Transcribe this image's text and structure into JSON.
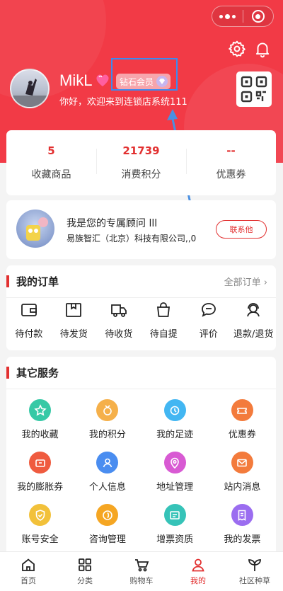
{
  "profile": {
    "username": "MikL",
    "vip_label": "钻石会员",
    "welcome": "你好，欢迎来到连锁店系统111"
  },
  "stats": [
    {
      "value": "5",
      "label": "收藏商品"
    },
    {
      "value": "21739",
      "label": "消费积分"
    },
    {
      "value": "--",
      "label": "优惠券"
    }
  ],
  "advisor": {
    "title": "我是您的专属顾问 lll",
    "company": "易族智汇（北京）科技有限公司,,0",
    "contact_label": "联系他"
  },
  "orders": {
    "title": "我的订单",
    "all_label": "全部订单",
    "items": [
      {
        "label": "待付款",
        "icon": "wallet-icon"
      },
      {
        "label": "待发货",
        "icon": "package-icon"
      },
      {
        "label": "待收货",
        "icon": "truck-icon"
      },
      {
        "label": "待自提",
        "icon": "bag-icon"
      },
      {
        "label": "评价",
        "icon": "comment-icon"
      },
      {
        "label": "退款/退货",
        "icon": "service-icon"
      }
    ]
  },
  "services": {
    "title": "其它服务",
    "items": [
      {
        "label": "我的收藏",
        "icon": "star-icon",
        "color": "#36c9a6"
      },
      {
        "label": "我的积分",
        "icon": "medal-icon",
        "color": "#f5b04a"
      },
      {
        "label": "我的足迹",
        "icon": "footprint-icon",
        "color": "#42b6f2"
      },
      {
        "label": "优惠券",
        "icon": "coupon-icon",
        "color": "#f37b3c"
      },
      {
        "label": "我的膨胀券",
        "icon": "inflate-coupon-icon",
        "color": "#ef5b3f"
      },
      {
        "label": "个人信息",
        "icon": "user-icon",
        "color": "#4a8df0"
      },
      {
        "label": "地址管理",
        "icon": "location-icon",
        "color": "#d85ad3"
      },
      {
        "label": "站内消息",
        "icon": "mail-icon",
        "color": "#f37b3c"
      },
      {
        "label": "账号安全",
        "icon": "shield-icon",
        "color": "#f2c13a"
      },
      {
        "label": "咨询管理",
        "icon": "consult-icon",
        "color": "#f5a623"
      },
      {
        "label": "增票资质",
        "icon": "invoice-qual-icon",
        "color": "#36c3b8"
      },
      {
        "label": "我的发票",
        "icon": "receipt-icon",
        "color": "#9b6df0"
      }
    ]
  },
  "tabbar": {
    "items": [
      {
        "label": "首页",
        "icon": "home-icon"
      },
      {
        "label": "分类",
        "icon": "category-icon"
      },
      {
        "label": "购物车",
        "icon": "cart-icon"
      },
      {
        "label": "我的",
        "icon": "profile-icon"
      },
      {
        "label": "社区种草",
        "icon": "sprout-icon"
      }
    ],
    "active": "我的"
  },
  "colors": {
    "brand": "#f23a46",
    "accent": "#e23030",
    "highlight": "#3b8bf0"
  }
}
